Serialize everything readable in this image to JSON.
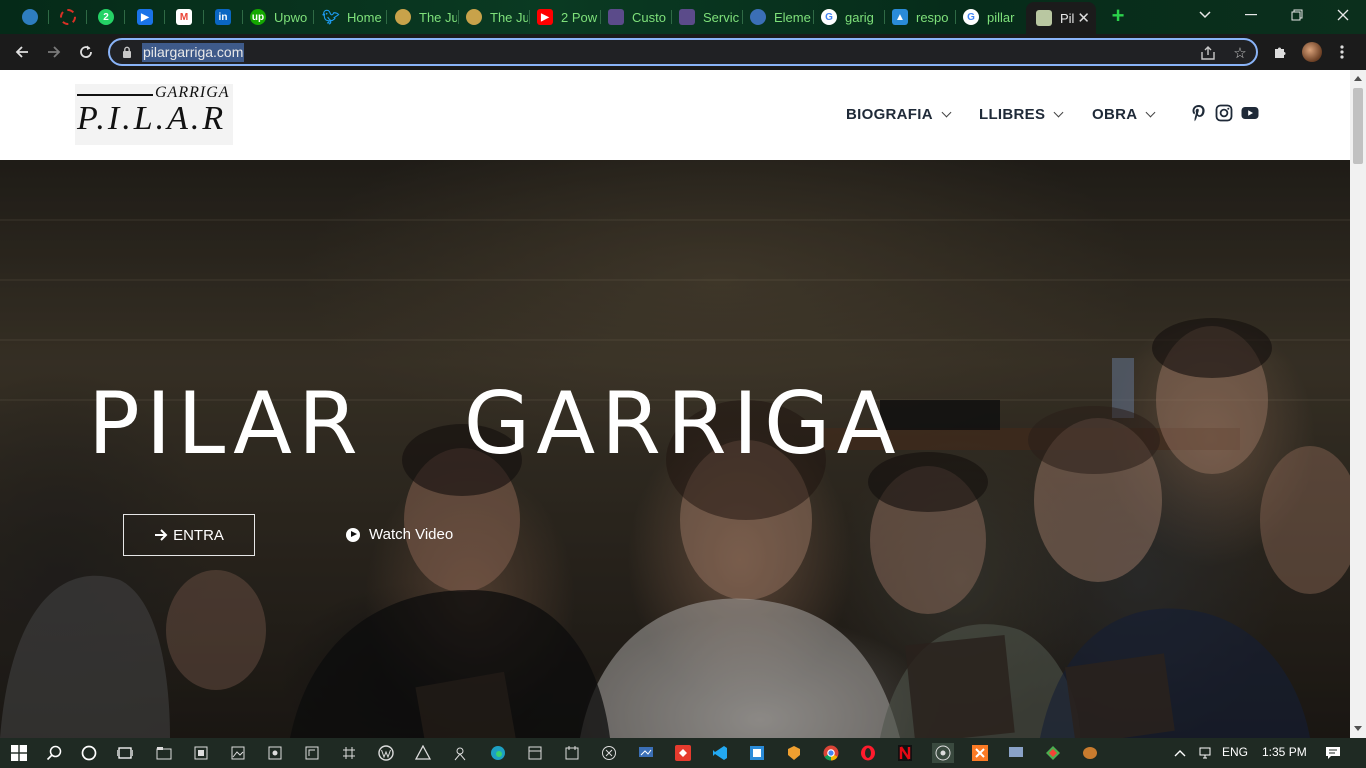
{
  "browser": {
    "tabs": [
      {
        "label": "",
        "fav_color": "#2e7dbf"
      },
      {
        "label": "",
        "fav_color": "#d93025"
      },
      {
        "label": "",
        "fav_color": "#25d366",
        "fav_text": "2"
      },
      {
        "label": "",
        "fav_color": "#1a73e8"
      },
      {
        "label": "",
        "fav_color": "#ea4335"
      },
      {
        "label": "",
        "fav_color": "#0a66c2"
      },
      {
        "label": "Upwo",
        "fav_color": "#14a800"
      },
      {
        "label": "Home",
        "fav_color": "#1d9bf0"
      },
      {
        "label": "The Ju",
        "fav_color": "#c8a24a"
      },
      {
        "label": "The Ju",
        "fav_color": "#c8a24a"
      },
      {
        "label": "2 Pow",
        "fav_color": "#ff0000"
      },
      {
        "label": "Custo",
        "fav_color": "#5b4b8a"
      },
      {
        "label": "Servic",
        "fav_color": "#5b4b8a"
      },
      {
        "label": "Eleme",
        "fav_color": "#3b6fb6"
      },
      {
        "label": "garig",
        "fav_color": "#4285f4"
      },
      {
        "label": "respo",
        "fav_color": "#2a8bd8"
      },
      {
        "label": "pillar",
        "fav_color": "#4285f4"
      },
      {
        "label": "Pil",
        "fav_color": "#b9c7a1",
        "active": true
      }
    ],
    "url": "pilargarriga.com"
  },
  "site": {
    "logo": {
      "top": "GARRIGA",
      "main": "P.I.L.A.R"
    },
    "nav": [
      {
        "label": "BIOGRAFIA"
      },
      {
        "label": "LLIBRES"
      },
      {
        "label": "OBRA"
      }
    ],
    "social": [
      "pinterest-icon",
      "instagram-icon",
      "youtube-icon"
    ],
    "hero": {
      "title": "PILAR   GARRIGA",
      "cta_label": "ENTRA",
      "video_label": "Watch Video"
    }
  },
  "taskbar": {
    "language": "ENG",
    "time": "1:35 PM"
  }
}
